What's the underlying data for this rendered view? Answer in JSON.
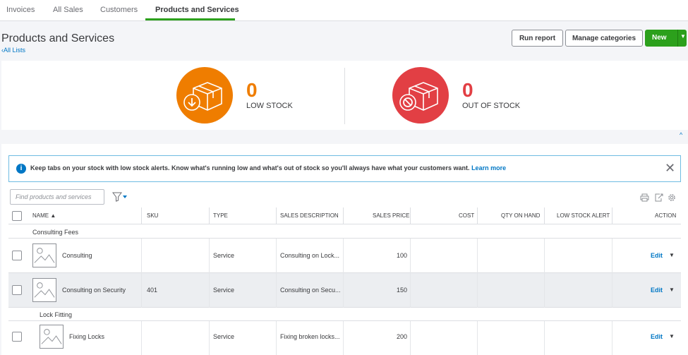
{
  "tabs": [
    {
      "label": "Invoices"
    },
    {
      "label": "All Sales"
    },
    {
      "label": "Customers"
    },
    {
      "label": "Products and Services",
      "active": true
    }
  ],
  "header": {
    "title": "Products and Services",
    "back_link": "All Lists",
    "run_report": "Run report",
    "manage_categories": "Manage categories",
    "new_label": "New"
  },
  "stock": {
    "low": {
      "count": "0",
      "label": "LOW STOCK"
    },
    "out": {
      "count": "0",
      "label": "OUT OF STOCK"
    }
  },
  "alert": {
    "text": "Keep tabs on your stock with low stock alerts. Know what's running low and what's out of stock so you'll always have what your customers want.",
    "link": "Learn more"
  },
  "search": {
    "placeholder": "Find products and services"
  },
  "table": {
    "columns": [
      "NAME ▲",
      "SKU",
      "TYPE",
      "SALES DESCRIPTION",
      "SALES PRICE",
      "COST",
      "QTY ON HAND",
      "LOW STOCK ALERT",
      "ACTION"
    ],
    "groups": [
      {
        "label": "Consulting Fees"
      },
      {
        "label": "Lock Fitting"
      }
    ],
    "rows": [
      {
        "name": "Consulting",
        "sku": "",
        "type": "Service",
        "description": "Consulting on Lock...",
        "price": "100",
        "action": "Edit"
      },
      {
        "name": "Consulting on Security",
        "sku": "401",
        "type": "Service",
        "description": "Consulting on Secu...",
        "price": "150",
        "action": "Edit"
      },
      {
        "name": "Fixing Locks",
        "sku": "",
        "type": "Service",
        "description": "Fixing broken locks...",
        "price": "200",
        "action": "Edit"
      }
    ]
  },
  "colors": {
    "brand_green": "#2ca01c",
    "low_stock_orange": "#ef7d00",
    "out_of_stock_red": "#e23f44",
    "link_blue": "#0077c5"
  },
  "icons": [
    "box-download-icon",
    "box-blocked-icon",
    "info-icon",
    "close-icon",
    "filter-icon",
    "print-icon",
    "export-icon",
    "settings-gear-icon",
    "image-placeholder-icon"
  ]
}
